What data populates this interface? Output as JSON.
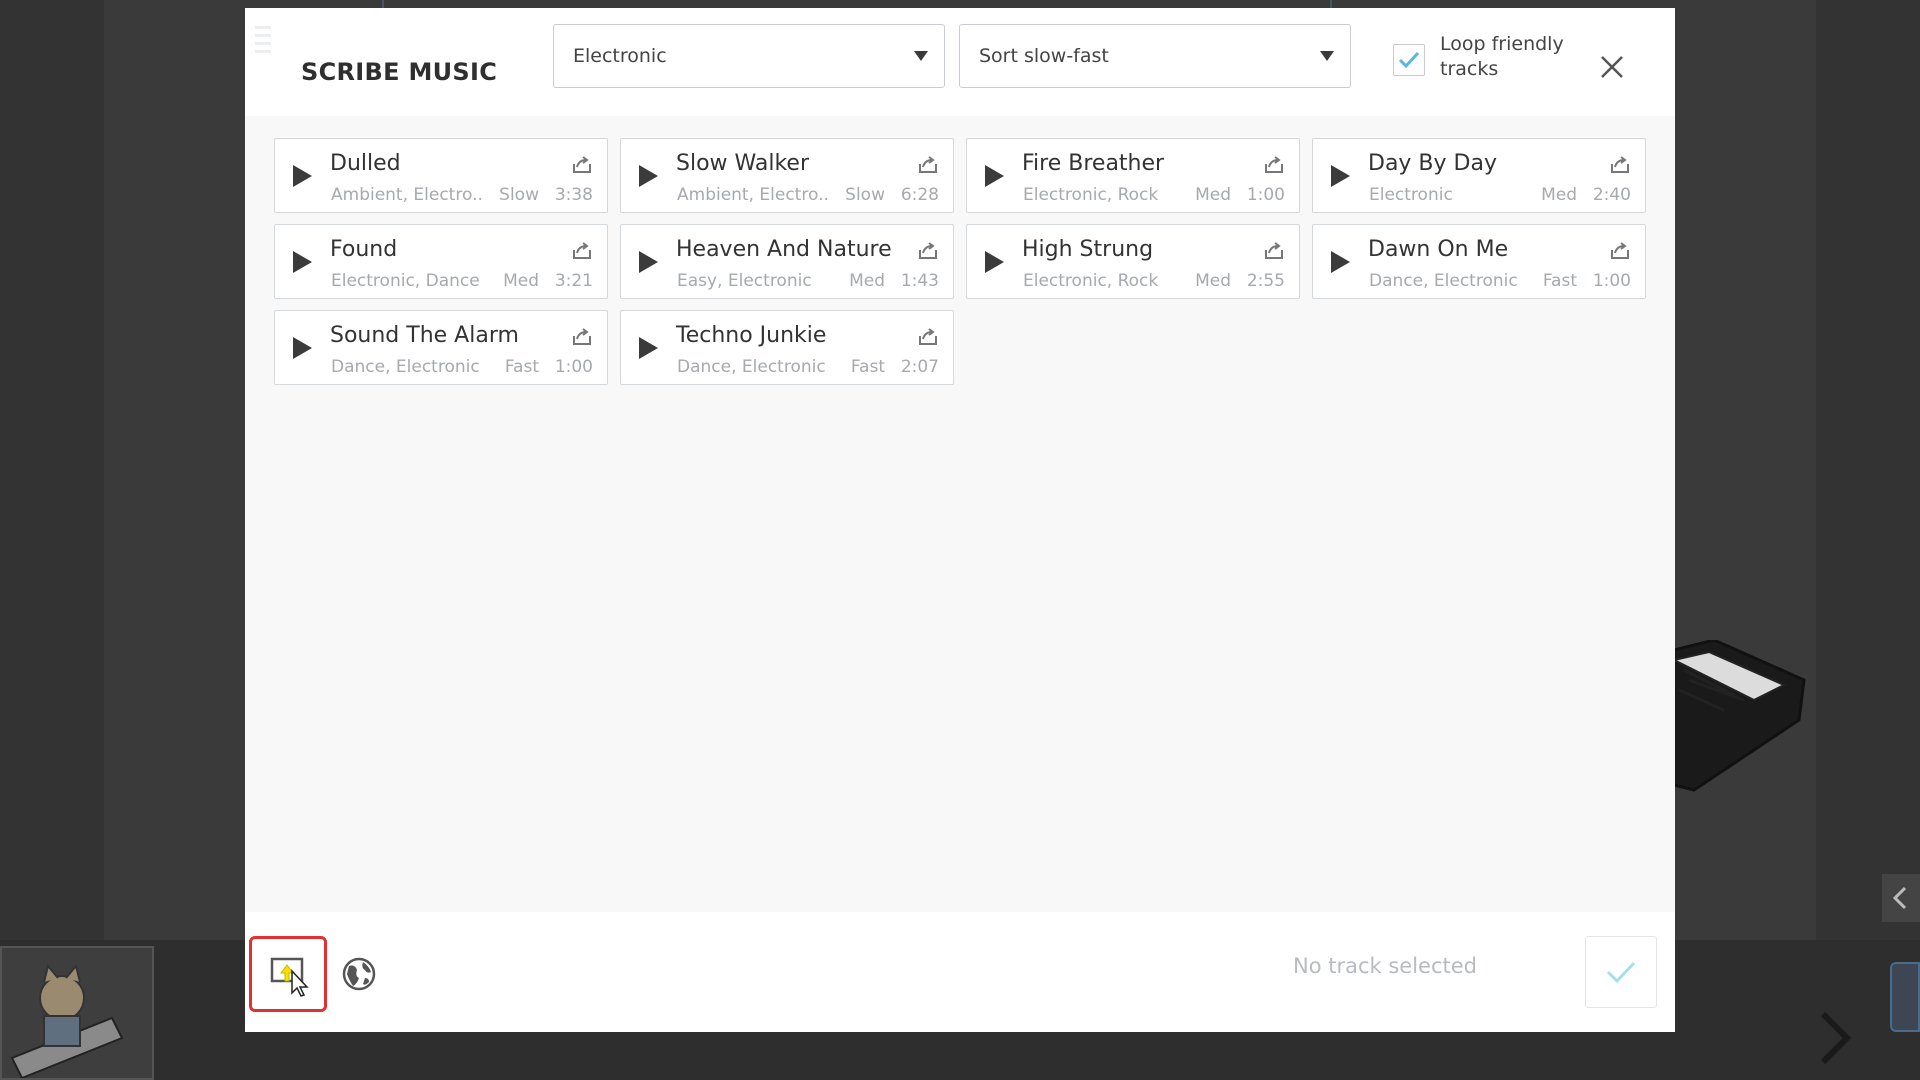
{
  "modal": {
    "title": "SCRIBE MUSIC",
    "genre_select": {
      "value": "Electronic"
    },
    "sort_select": {
      "value": "Sort slow-fast"
    },
    "loop_friendly": {
      "label": "Loop friendly tracks",
      "checked": true
    },
    "footer": {
      "status": "No track selected"
    }
  },
  "tracks": [
    {
      "name": "Dulled",
      "genres": "Ambient, Electro..",
      "speed": "Slow",
      "duration": "3:38"
    },
    {
      "name": "Slow Walker",
      "genres": "Ambient, Electro..",
      "speed": "Slow",
      "duration": "6:28"
    },
    {
      "name": "Fire Breather",
      "genres": "Electronic, Rock",
      "speed": "Med",
      "duration": "1:00"
    },
    {
      "name": "Day By Day",
      "genres": "Electronic",
      "speed": "Med",
      "duration": "2:40"
    },
    {
      "name": "Found",
      "genres": "Electronic, Dance",
      "speed": "Med",
      "duration": "3:21"
    },
    {
      "name": "Heaven And Nature",
      "genres": "Easy, Electronic",
      "speed": "Med",
      "duration": "1:43"
    },
    {
      "name": "High Strung",
      "genres": "Electronic, Rock",
      "speed": "Med",
      "duration": "2:55"
    },
    {
      "name": "Dawn On Me",
      "genres": "Dance, Electronic",
      "speed": "Fast",
      "duration": "1:00"
    },
    {
      "name": "Sound The Alarm",
      "genres": "Dance, Electronic",
      "speed": "Fast",
      "duration": "1:00"
    },
    {
      "name": "Techno Junkie",
      "genres": "Dance, Electronic",
      "speed": "Fast",
      "duration": "2:07"
    }
  ],
  "icons": {
    "play": "play-icon",
    "share": "share-icon",
    "upload": "upload-icon",
    "globe": "globe-icon",
    "close": "close-icon",
    "check": "check-icon"
  },
  "colors": {
    "accent_check": "#5bb8dc",
    "highlight_border": "#e03131",
    "cursor_highlight": "#f5e100"
  }
}
